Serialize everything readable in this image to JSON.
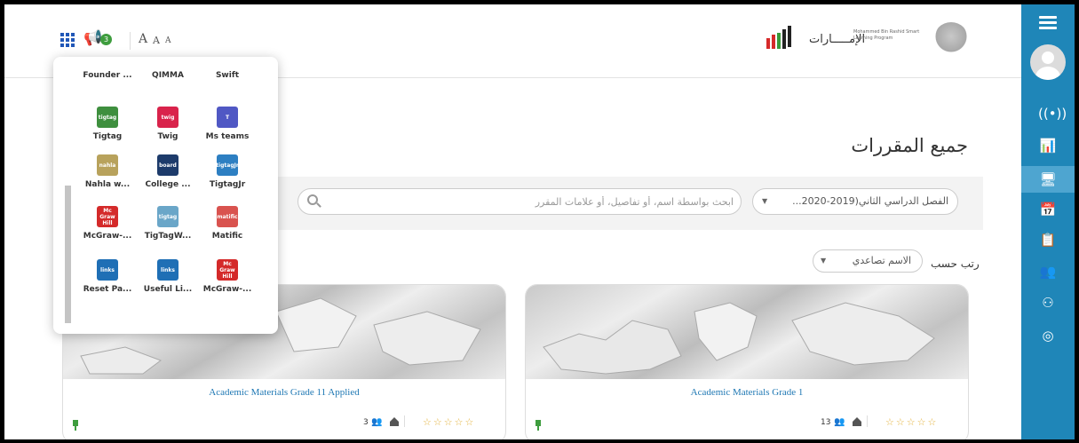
{
  "header": {
    "notif_count": "3",
    "font_sizes": [
      "A",
      "A",
      "A"
    ],
    "brand_name": "الإمـــــارات",
    "brand_program": "Mohammed Bin Rashid Smart Learning Program"
  },
  "main": {
    "title": "جميع المقررات",
    "semester": "الفصل الدراسي الثاني(2019-2020...",
    "search_placeholder": "ابحث بواسطة اسم، أو تفاصيل، أو علامات المقرر",
    "sort_label": "رتب حسب",
    "sort_value": "الاسم تصاعدي"
  },
  "courses": [
    {
      "title": "Academic Materials Grade 1",
      "count": "13",
      "stars": "☆☆☆☆☆"
    },
    {
      "title": "Academic Materials Grade 11 Applied",
      "count": "3",
      "stars": "☆☆☆☆☆"
    }
  ],
  "apps": [
    {
      "label": "Founder ...",
      "logo": "",
      "color": "#555"
    },
    {
      "label": "QIMMA",
      "logo": "",
      "color": "#555"
    },
    {
      "label": "Swift",
      "logo": "",
      "color": "#555"
    },
    {
      "label": "Tigtag",
      "logo": "tigtag",
      "color": "#3e8f3e"
    },
    {
      "label": "Twig",
      "logo": "twig",
      "color": "#d9234b"
    },
    {
      "label": "Ms teams",
      "logo": "T",
      "color": "#5058c4"
    },
    {
      "label": "Nahla w...",
      "logo": "nahla",
      "color": "#b8a25c"
    },
    {
      "label": "College ...",
      "logo": "board",
      "color": "#1d3b6b"
    },
    {
      "label": "TigtagJr",
      "logo": "tigtagJr",
      "color": "#2d7fc2"
    },
    {
      "label": "McGraw-...",
      "logo": "Mc Graw Hill",
      "color": "#d42a2a"
    },
    {
      "label": "TigTagW...",
      "logo": "tigtag",
      "color": "#6aa6c8"
    },
    {
      "label": "Matific",
      "logo": "matific",
      "color": "#d9534f"
    },
    {
      "label": "Reset Pa...",
      "logo": "links",
      "color": "#1f6fb5"
    },
    {
      "label": "Useful Li...",
      "logo": "links",
      "color": "#1f6fb5"
    },
    {
      "label": "McGraw-...",
      "logo": "Mc Graw Hill",
      "color": "#d42a2a"
    }
  ],
  "sidebar": {
    "icons": [
      "broadcast-icon",
      "analytics-icon",
      "courses-icon",
      "calendar-icon",
      "reports-icon",
      "groups-icon",
      "network-icon",
      "help-icon"
    ]
  }
}
